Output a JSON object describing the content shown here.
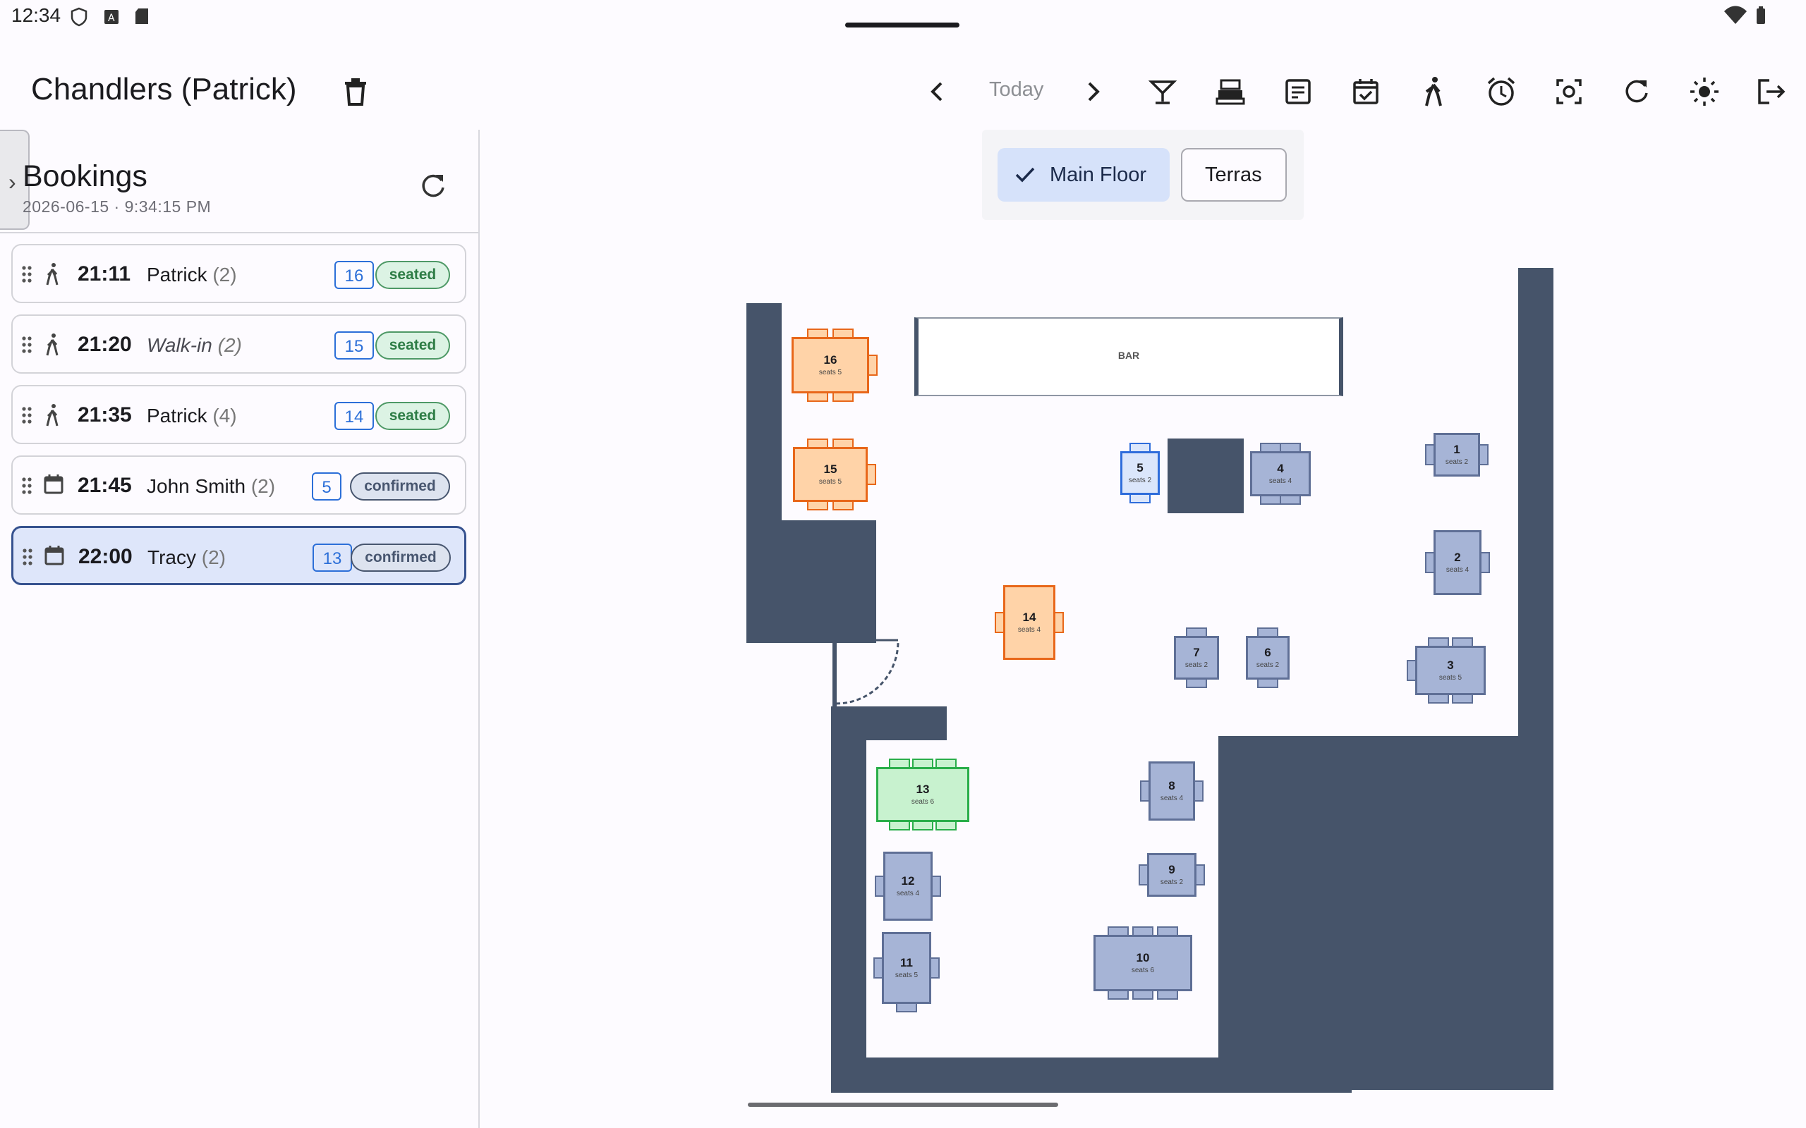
{
  "status_bar": {
    "time": "12:34",
    "top_handle": true
  },
  "app_bar": {
    "title": "Chandlers (Patrick)",
    "today_label": "Today",
    "icons": [
      "delete-icon",
      "chevron-left-icon",
      "chevron-right-icon",
      "cocktail-icon",
      "cash-register-icon",
      "receipt-icon",
      "calendar-check-icon",
      "walk-in-icon",
      "alarm-icon",
      "focus-icon",
      "refresh-icon",
      "brightness-icon",
      "logout-icon"
    ]
  },
  "bookings": {
    "title": "Bookings",
    "date": "2026-06-15 · 9:34:15 PM",
    "items": [
      {
        "kind": "walk",
        "time": "21:11",
        "name": "Patrick",
        "party": "(2)",
        "table": "16",
        "status": "seated",
        "italic": false,
        "selected": false
      },
      {
        "kind": "walk",
        "time": "21:20",
        "name": "Walk-in",
        "party": "(2)",
        "table": "15",
        "status": "seated",
        "italic": true,
        "selected": false
      },
      {
        "kind": "walk",
        "time": "21:35",
        "name": "Patrick",
        "party": "(4)",
        "table": "14",
        "status": "seated",
        "italic": false,
        "selected": false
      },
      {
        "kind": "calendar",
        "time": "21:45",
        "name": "John Smith",
        "party": "(2)",
        "table": "5",
        "status": "confirmed",
        "italic": false,
        "selected": false
      },
      {
        "kind": "calendar",
        "time": "22:00",
        "name": "Tracy",
        "party": "(2)",
        "table": "13",
        "status": "confirmed",
        "italic": false,
        "selected": true
      }
    ]
  },
  "floor_tabs": [
    {
      "label": "Main Floor",
      "selected": true
    },
    {
      "label": "Terras",
      "selected": false
    }
  ],
  "floor": {
    "bar_label": "BAR",
    "tables": [
      {
        "num": "16",
        "sub": "seats 5",
        "state": "seated"
      },
      {
        "num": "15",
        "sub": "seats 5",
        "state": "seated"
      },
      {
        "num": "5",
        "sub": "seats 2",
        "state": "selected"
      },
      {
        "num": "4",
        "sub": "seats 4",
        "state": "free"
      },
      {
        "num": "1",
        "sub": "seats 2",
        "state": "free"
      },
      {
        "num": "2",
        "sub": "seats 4",
        "state": "free"
      },
      {
        "num": "14",
        "sub": "seats 4",
        "state": "seated"
      },
      {
        "num": "7",
        "sub": "seats 2",
        "state": "free"
      },
      {
        "num": "6",
        "sub": "seats 2",
        "state": "free"
      },
      {
        "num": "3",
        "sub": "seats 5",
        "state": "free"
      },
      {
        "num": "13",
        "sub": "seats 6",
        "state": "reserved"
      },
      {
        "num": "8",
        "sub": "seats 4",
        "state": "free"
      },
      {
        "num": "12",
        "sub": "seats 4",
        "state": "free"
      },
      {
        "num": "9",
        "sub": "seats 2",
        "state": "free"
      },
      {
        "num": "11",
        "sub": "seats 5",
        "state": "free"
      },
      {
        "num": "10",
        "sub": "seats 6",
        "state": "free"
      }
    ]
  },
  "colors": {
    "seated_fill": "#ffd3a8",
    "seated_stroke": "#e8671a",
    "free_fill": "#a6b4d6",
    "free_stroke": "#5f6f96",
    "reserved_fill": "#c8f2cf",
    "reserved_stroke": "#2aae4a",
    "selected_fill": "#dbe6fb",
    "selected_stroke": "#2f6ddb",
    "wall": "#46546a"
  }
}
